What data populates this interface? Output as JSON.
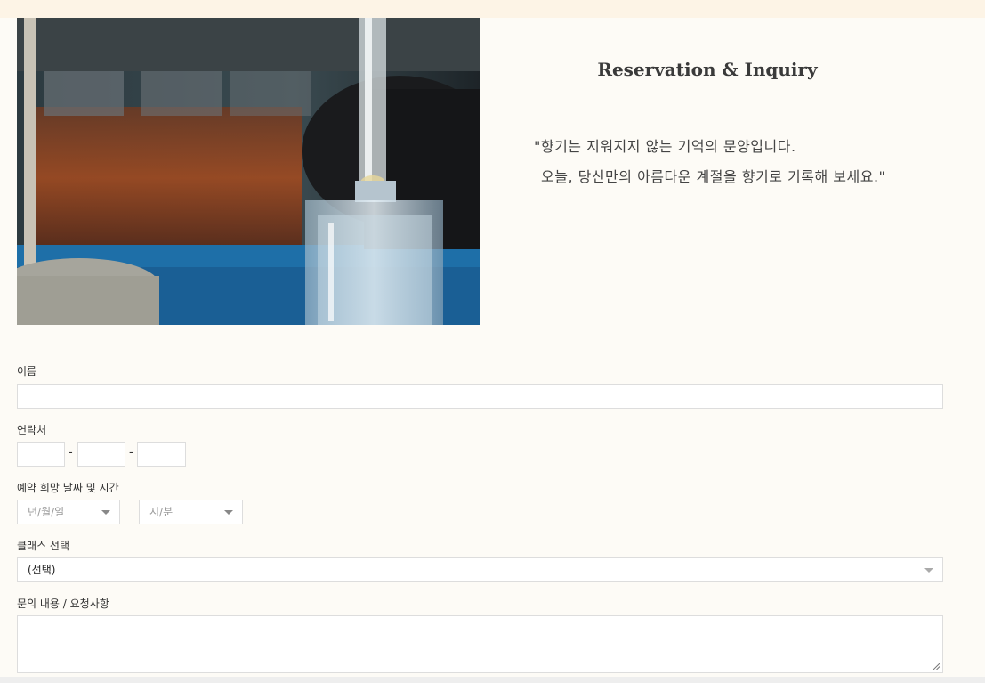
{
  "heading": "Reservation & Inquiry",
  "quote": {
    "line1": "\"향기는 지워지지 않는 기억의 문양입니다.",
    "line2": "오늘, 당신만의 아름다운 계절을 향기로 기록해 보세요.\""
  },
  "form": {
    "name_label": "이름",
    "phone_label": "연락처",
    "phone_separator": "-",
    "datetime_label": "예약 희망 날짜 및 시간",
    "date_placeholder": "년/월/일",
    "time_placeholder": "시/분",
    "class_label": "클래스 선택",
    "class_selected": "(선택)",
    "inquiry_label": "문의 내용 / 요청사항"
  },
  "icons": {
    "select_caret": "caret-down-icon",
    "resize_handle": "resize-handle-icon"
  }
}
